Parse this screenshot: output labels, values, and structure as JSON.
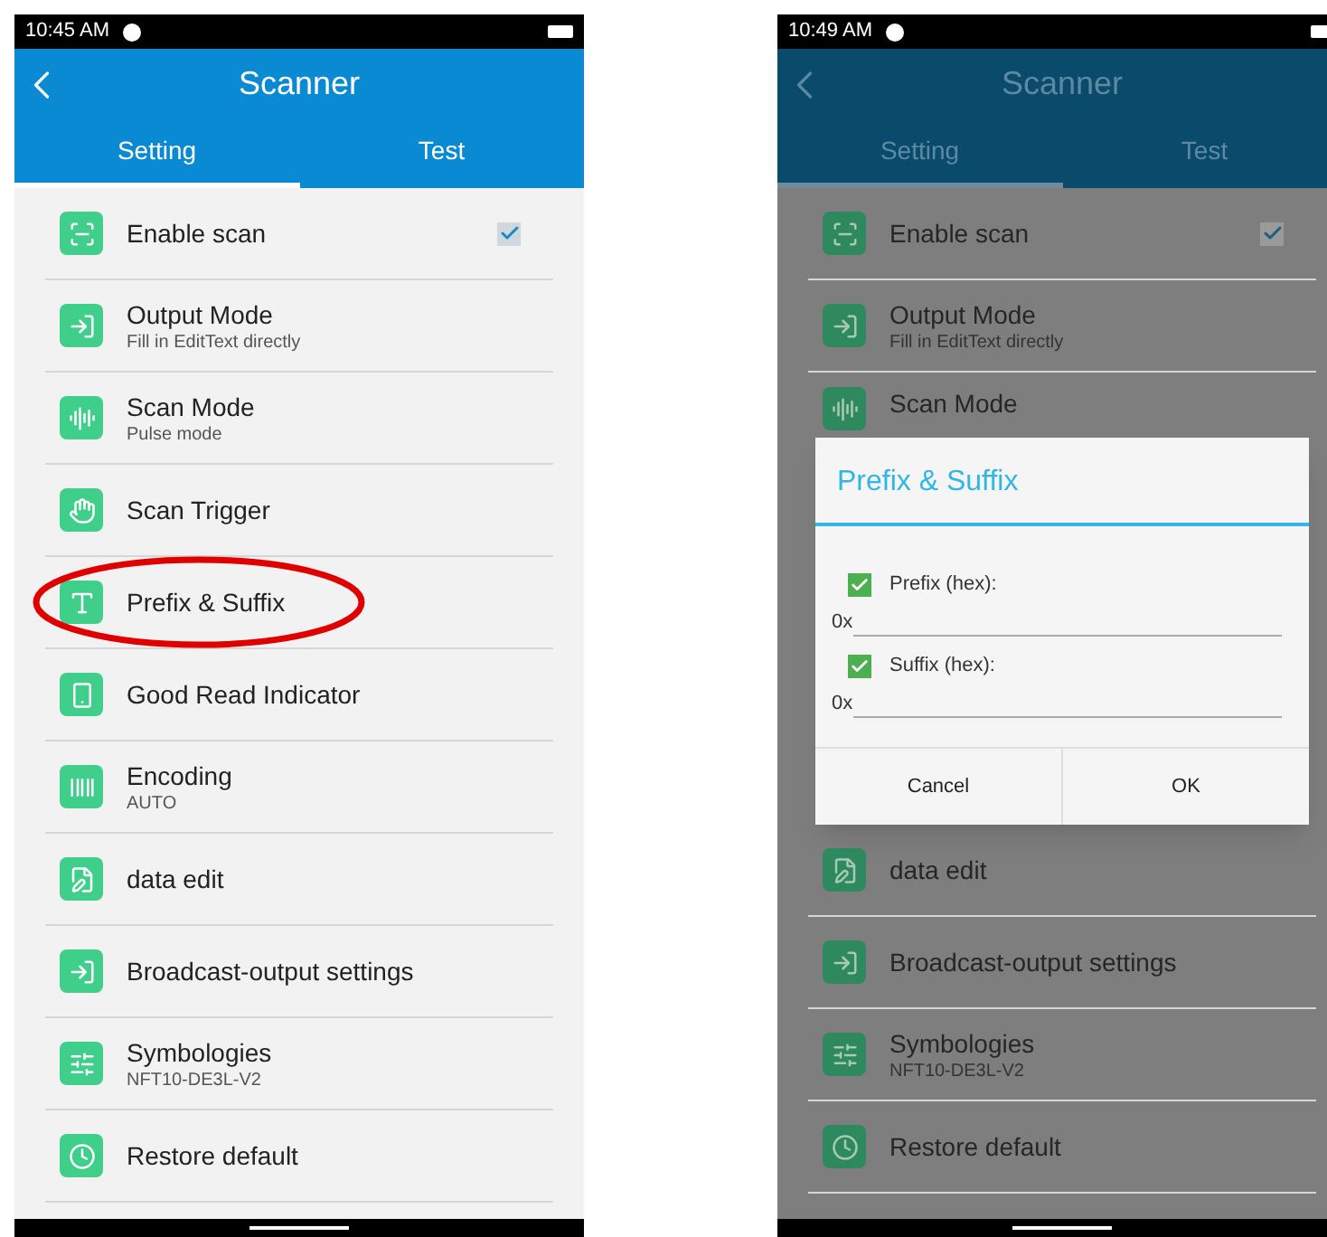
{
  "screens": [
    {
      "dimmed": false,
      "status_time": "10:45 AM",
      "title": "Scanner",
      "tabs": [
        {
          "label": "Setting",
          "selected": true
        },
        {
          "label": "Test",
          "selected": false
        }
      ],
      "items": [
        {
          "kind": "checkbox",
          "title": "Enable scan",
          "checked": true,
          "circled": false
        },
        {
          "kind": "plain",
          "title": "Output Mode",
          "subtitle": "Fill in EditText directly",
          "circled": false
        },
        {
          "kind": "plain",
          "title": "Scan Mode",
          "subtitle": "Pulse mode",
          "circled": false
        },
        {
          "kind": "plain",
          "title": "Scan Trigger",
          "circled": false
        },
        {
          "kind": "plain",
          "title": "Prefix & Suffix",
          "circled": true
        },
        {
          "kind": "plain",
          "title": "Good Read Indicator",
          "circled": false
        },
        {
          "kind": "plain",
          "title": "Encoding",
          "subtitle": "AUTO",
          "circled": false
        },
        {
          "kind": "plain",
          "title": "data edit",
          "circled": false
        },
        {
          "kind": "plain",
          "title": "Broadcast-output settings",
          "circled": false
        },
        {
          "kind": "plain",
          "title": "Symbologies",
          "subtitle": "NFT10-DE3L-V2",
          "circled": false
        },
        {
          "kind": "plain",
          "title": "Restore default",
          "circled": false
        }
      ]
    },
    {
      "dimmed": true,
      "status_time": "10:49 AM",
      "title": "Scanner",
      "tabs": [
        {
          "label": "Setting",
          "selected": true
        },
        {
          "label": "Test",
          "selected": false
        }
      ],
      "items": [
        {
          "kind": "checkbox",
          "title": "Enable scan",
          "checked": true,
          "circled": false
        },
        {
          "kind": "plain",
          "title": "Output Mode",
          "subtitle": "Fill in EditText directly",
          "circled": false
        },
        {
          "kind": "plain",
          "title": "Scan Mode",
          "circled": false
        },
        {
          "kind": "dialog"
        },
        {
          "kind": "plain",
          "title": "data edit",
          "circled": false
        },
        {
          "kind": "plain",
          "title": "Broadcast-output settings",
          "circled": false
        },
        {
          "kind": "plain",
          "title": "Symbologies",
          "subtitle": "NFT10-DE3L-V2",
          "circled": false
        },
        {
          "kind": "plain",
          "title": "Restore default",
          "circled": false
        }
      ],
      "dialog": {
        "title": "Prefix & Suffix",
        "fields": [
          {
            "label": "Prefix (hex):",
            "checked": true,
            "prefix": "0x"
          },
          {
            "label": "Suffix (hex):",
            "checked": true,
            "prefix": "0x"
          }
        ],
        "buttons": [
          "Cancel",
          "OK"
        ]
      }
    }
  ]
}
